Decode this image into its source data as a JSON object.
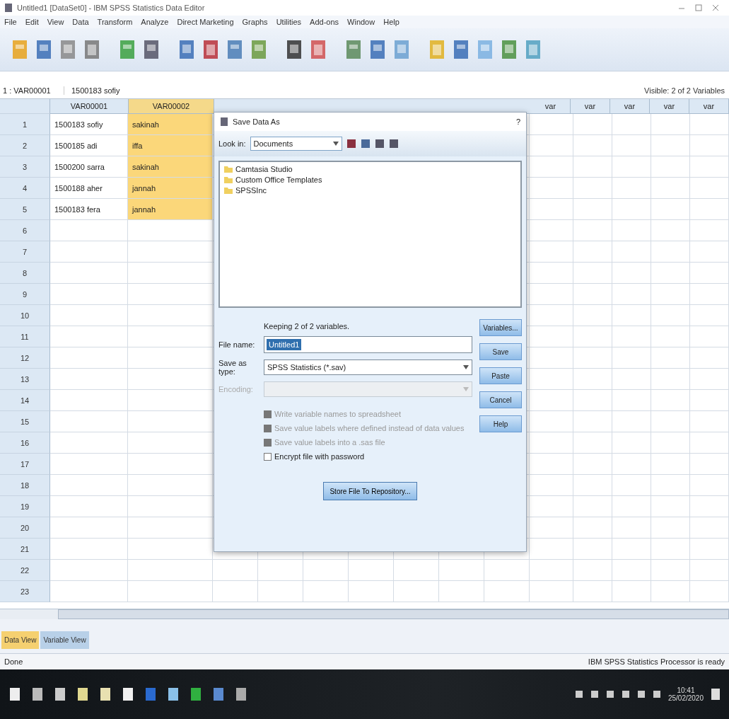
{
  "window": {
    "title": "Untitled1 [DataSet0] - IBM SPSS Statistics Data Editor"
  },
  "menu": [
    "File",
    "Edit",
    "View",
    "Data",
    "Transform",
    "Analyze",
    "Direct Marketing",
    "Graphs",
    "Utilities",
    "Add-ons",
    "Window",
    "Help"
  ],
  "cell_editor": {
    "reference": "1 : VAR00001",
    "value": "1500183 sofiy",
    "visible_count": "Visible: 2 of 2 Variables"
  },
  "grid": {
    "columns": [
      {
        "label": "VAR00001",
        "highlighted": false
      },
      {
        "label": "VAR00002",
        "highlighted": true
      }
    ],
    "spare_columns": [
      "var",
      "var",
      "var",
      "var",
      "var"
    ],
    "rows": [
      {
        "number": "1",
        "cells": [
          "1500183 sofiy",
          "sakinah"
        ]
      },
      {
        "number": "2",
        "cells": [
          "1500185 adi",
          "iffa"
        ]
      },
      {
        "number": "3",
        "cells": [
          "1500200 sarra",
          "sakinah"
        ]
      },
      {
        "number": "4",
        "cells": [
          "1500188 aher",
          "jannah"
        ]
      },
      {
        "number": "5",
        "cells": [
          "1500183 fera",
          "jannah"
        ]
      },
      {
        "number": "6",
        "cells": []
      },
      {
        "number": "7",
        "cells": []
      },
      {
        "number": "8",
        "cells": []
      },
      {
        "number": "9",
        "cells": []
      },
      {
        "number": "10",
        "cells": []
      },
      {
        "number": "11",
        "cells": []
      },
      {
        "number": "12",
        "cells": []
      },
      {
        "number": "13",
        "cells": []
      },
      {
        "number": "14",
        "cells": []
      },
      {
        "number": "15",
        "cells": []
      },
      {
        "number": "16",
        "cells": []
      },
      {
        "number": "17",
        "cells": []
      },
      {
        "number": "18",
        "cells": []
      },
      {
        "number": "19",
        "cells": []
      },
      {
        "number": "20",
        "cells": []
      },
      {
        "number": "21",
        "cells": []
      },
      {
        "number": "22",
        "cells": []
      },
      {
        "number": "23",
        "cells": []
      }
    ]
  },
  "dialog": {
    "title": "Save Data As",
    "help": "?",
    "look_in_label": "Look in:",
    "look_in_value": "Documents",
    "files": [
      "Camtasia Studio",
      "Custom Office Templates",
      "SPSSInc"
    ],
    "keeping": "Keeping 2 of 2 variables.",
    "file_name_label": "File name:",
    "file_name_value": "Untitled1",
    "save_type_label": "Save as type:",
    "save_type_value": "SPSS Statistics (*.sav)",
    "encoding_label": "Encoding:",
    "options": [
      {
        "label": "Write variable names to spreadsheet",
        "checked": false,
        "disabled": true
      },
      {
        "label": "Save value labels where defined instead of data values",
        "checked": false,
        "disabled": true
      },
      {
        "label": "Save value labels into a .sas file",
        "checked": false,
        "disabled": true
      },
      {
        "label": "Encrypt file with password",
        "checked": false,
        "disabled": false
      }
    ],
    "buttons": [
      "Variables...",
      "Save",
      "Paste",
      "Cancel",
      "Help"
    ],
    "repository_button": "Store File To Repository..."
  },
  "view_tabs": [
    {
      "label": "Data View",
      "selected": true
    },
    {
      "label": "Variable View",
      "selected": false
    }
  ],
  "status_bar": {
    "left": "Done",
    "right": "IBM SPSS Statistics Processor is ready"
  },
  "taskbar": {
    "time": "10:41",
    "date": "25/02/2020"
  }
}
